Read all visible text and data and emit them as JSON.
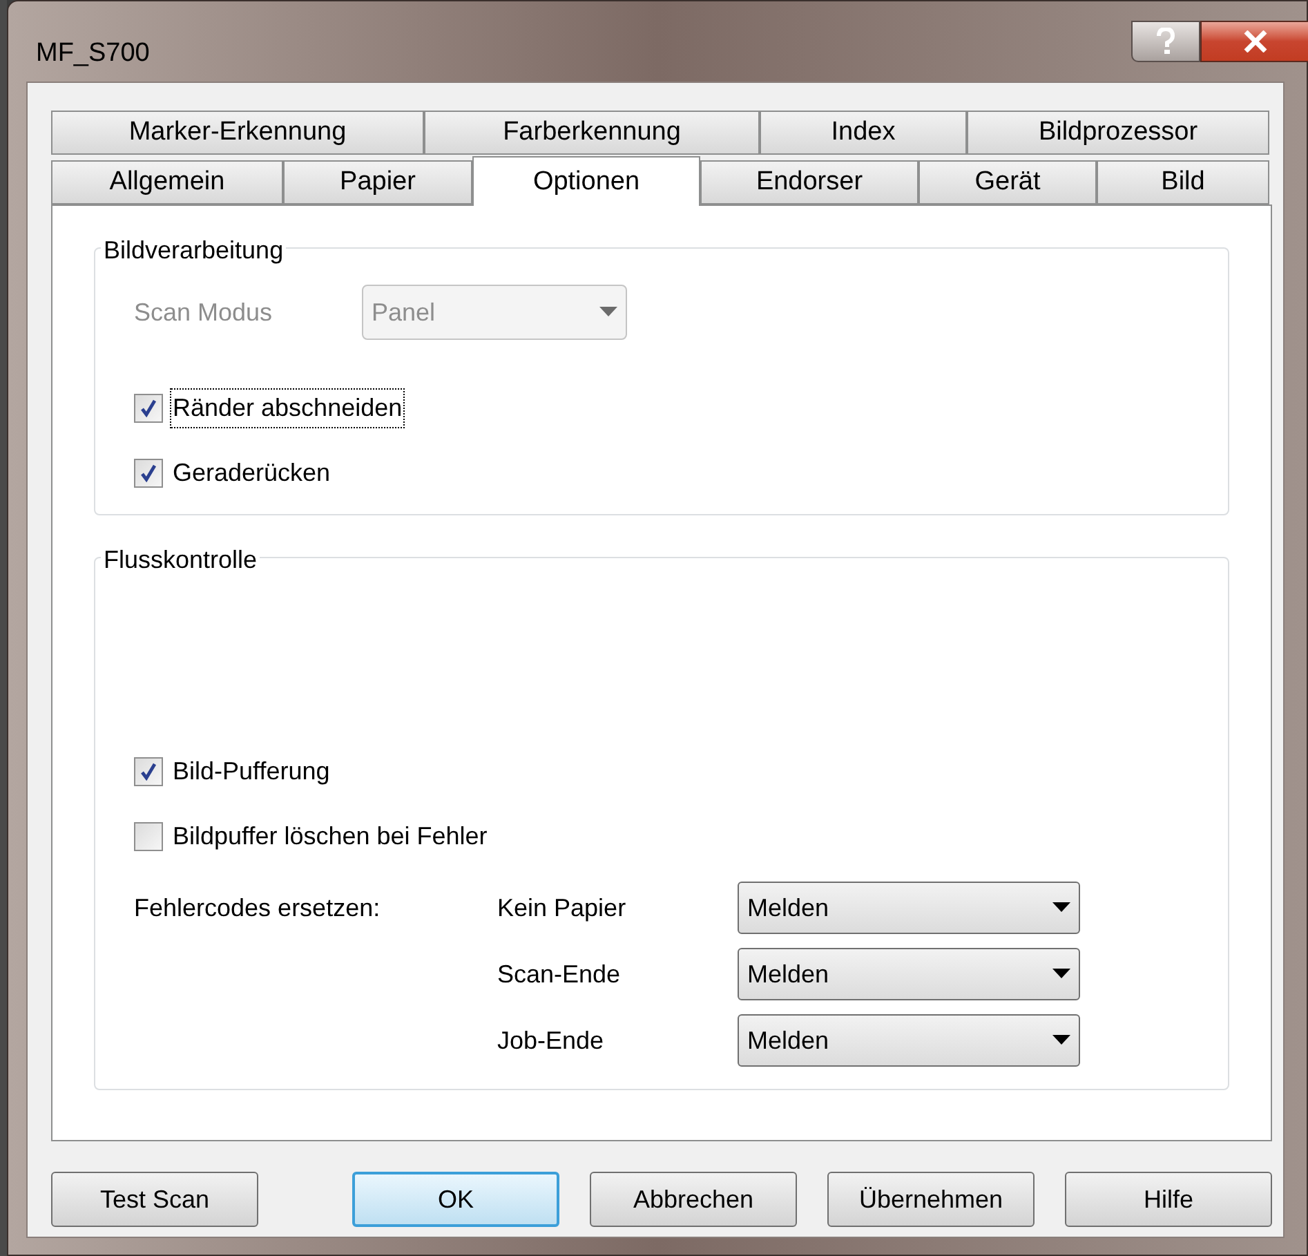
{
  "window": {
    "title": "MF_S700"
  },
  "tab_rows": [
    [
      {
        "label": "Marker-Erkennung",
        "selected": false
      },
      {
        "label": "Farberkennung",
        "selected": false
      },
      {
        "label": "Index",
        "selected": false
      },
      {
        "label": "Bildprozessor",
        "selected": false
      }
    ],
    [
      {
        "label": "Allgemein",
        "selected": false
      },
      {
        "label": "Papier",
        "selected": false
      },
      {
        "label": "Optionen",
        "selected": true
      },
      {
        "label": "Endorser",
        "selected": false
      },
      {
        "label": "Gerät",
        "selected": false
      },
      {
        "label": "Bild",
        "selected": false
      }
    ]
  ],
  "groups": [
    {
      "title": "Bildverarbeitung",
      "items": [
        {
          "kind": "dropdown",
          "label": "Scan Modus",
          "value": "Panel",
          "disabled": true
        },
        {
          "kind": "checkbox",
          "label": "Ränder abschneiden",
          "checked": true,
          "focused": true
        },
        {
          "kind": "checkbox",
          "label": "Geraderücken",
          "checked": true,
          "focused": false
        }
      ]
    },
    {
      "title": "Flusskontrolle",
      "items": [
        {
          "kind": "checkbox",
          "label": "Bild-Pufferung",
          "checked": true,
          "focused": false
        },
        {
          "kind": "checkbox",
          "label": "Bildpuffer löschen bei Fehler",
          "checked": false,
          "focused": false
        },
        {
          "kind": "mapping",
          "label": "Fehlercodes ersetzen:",
          "rows": [
            {
              "label": "Kein Papier",
              "value": "Melden"
            },
            {
              "label": "Scan-Ende",
              "value": "Melden"
            },
            {
              "label": "Job-Ende",
              "value": "Melden"
            }
          ]
        }
      ]
    }
  ],
  "buttons": [
    {
      "label": "Test Scan",
      "default": false
    },
    {
      "label": "OK",
      "default": true
    },
    {
      "label": "Abbrechen",
      "default": false
    },
    {
      "label": "Übernehmen",
      "default": false
    },
    {
      "label": "Hilfe",
      "default": false
    }
  ]
}
